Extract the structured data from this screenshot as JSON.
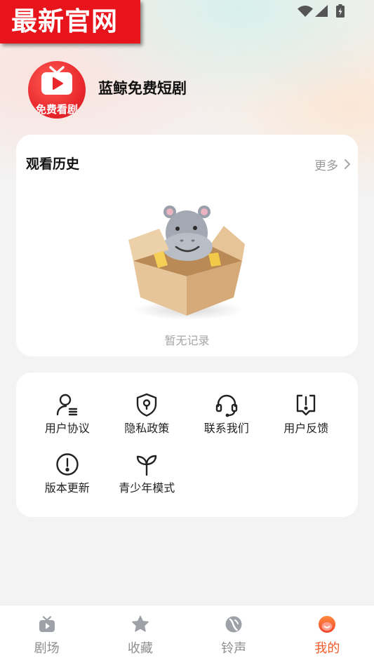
{
  "banner": {
    "text": "最新官网"
  },
  "status_bar": {
    "icons": [
      "wifi-icon",
      "signal-icon",
      "battery-icon"
    ]
  },
  "profile": {
    "avatar_caption": "免费看剧",
    "app_name": "蓝鲸免费短剧"
  },
  "history": {
    "title": "观看历史",
    "more": "更多",
    "empty": "暂无记录",
    "illustration": "hippo-box-illustration"
  },
  "menu": {
    "items": [
      {
        "label": "用户协议",
        "icon": "user-agreement-icon"
      },
      {
        "label": "隐私政策",
        "icon": "privacy-shield-icon"
      },
      {
        "label": "联系我们",
        "icon": "headset-icon"
      },
      {
        "label": "用户反馈",
        "icon": "feedback-icon"
      },
      {
        "label": "版本更新",
        "icon": "update-alert-icon"
      },
      {
        "label": "青少年模式",
        "icon": "sprout-icon"
      }
    ]
  },
  "tabbar": {
    "items": [
      {
        "label": "剧场",
        "icon": "theater-icon",
        "active": false
      },
      {
        "label": "收藏",
        "icon": "star-icon",
        "active": false
      },
      {
        "label": "铃声",
        "icon": "ringtone-icon",
        "active": false
      },
      {
        "label": "我的",
        "icon": "profile-icon",
        "active": true
      }
    ]
  },
  "colors": {
    "banner": "#e8141b",
    "accent": "#f25c2b",
    "inactive": "#9ea1a7",
    "text": "#1b1b1b",
    "muted": "#a3a3a3",
    "background": "#f3f3f3",
    "card": "#ffffff"
  }
}
